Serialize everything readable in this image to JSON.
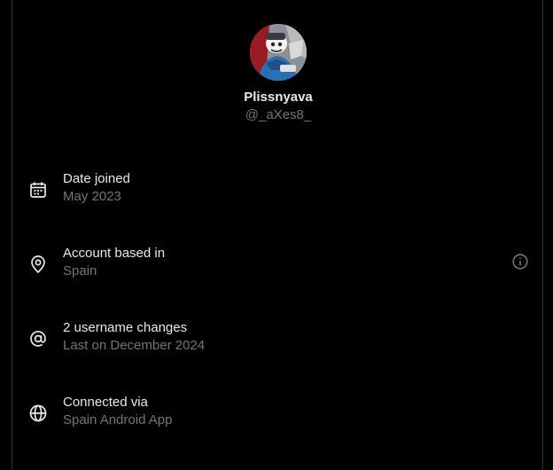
{
  "profile": {
    "display_name": "Plissnyava",
    "handle": "@_aXes8_"
  },
  "rows": [
    {
      "icon": "calendar-icon",
      "title": "Date joined",
      "value": "May 2023"
    },
    {
      "icon": "location-pin-icon",
      "title": "Account based in",
      "value": "Spain",
      "has_info": true
    },
    {
      "icon": "at-sign-icon",
      "title": "2 username changes",
      "value": "Last on December 2024"
    },
    {
      "icon": "globe-icon",
      "title": "Connected via",
      "value": "Spain Android App"
    }
  ],
  "colors": {
    "background": "#000000",
    "primary_text": "#e7e9ea",
    "secondary_text": "#71767b",
    "border": "#2f3336"
  }
}
